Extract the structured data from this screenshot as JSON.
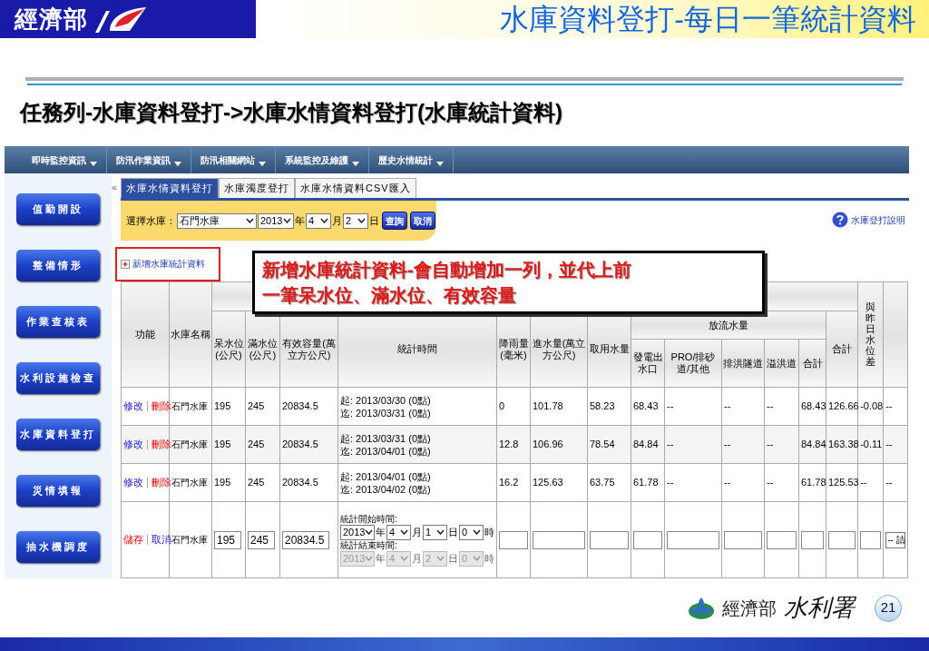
{
  "slide": {
    "org": "經濟部",
    "title": "水庫資料登打-每日一筆統計資料",
    "subtitle": "任務列-水庫資料登打->水庫水情資料登打(水庫統計資料)",
    "footer_org": "經濟部",
    "footer_agency": "水利署",
    "page": "21"
  },
  "menu": [
    {
      "label": "即時監控資訊"
    },
    {
      "label": "防汛作業資訊"
    },
    {
      "label": "防汛相關網站"
    },
    {
      "label": "系統監控及維護"
    },
    {
      "label": "歷史水情統計"
    }
  ],
  "sidebar": {
    "collapse": "«",
    "items": [
      "值勤開設",
      "整備情形",
      "作業查核表",
      "水利設施檢查",
      "水庫資料登打",
      "災情填報",
      "抽水機調度"
    ]
  },
  "tabs": [
    {
      "label": "水庫水情資料登打",
      "selected": true
    },
    {
      "label": "水庫濁度登打",
      "selected": false
    },
    {
      "label": "水庫水情資料CSV匯入",
      "selected": false
    }
  ],
  "filter": {
    "label": "選擇水庫：",
    "reservoir": "石門水庫",
    "parts": [
      {
        "value": "2013",
        "unit": "年"
      },
      {
        "value": "4",
        "unit": "月"
      },
      {
        "value": "2",
        "unit": "日"
      }
    ],
    "buttons": [
      "查詢",
      "取消"
    ]
  },
  "help_link": "水庫登打說明",
  "add_link": "新增水庫統計資料",
  "callout": [
    "新增水庫統計資料-會自動增加一列，並代上前",
    "一筆呆水位、滿水位、有效容量"
  ],
  "table": {
    "head": {
      "function": "功能",
      "name": "水庫名稱",
      "dead": "呆水位(公尺)",
      "full": "滿水位(公尺)",
      "capacity": "有效容量(萬立方公尺)",
      "period": "統計時間",
      "rain": "降雨量(毫米)",
      "inflow": "進水量(萬立方公尺)",
      "use": "取用水量",
      "release": "放流水量",
      "release_cols": [
        "發電出水口",
        "PRO/排砂道/其他",
        "排洪隧道",
        "溢洪道",
        "合計"
      ],
      "total": "合計",
      "diff": "與昨日水位差"
    },
    "rows": [
      {
        "actions": [
          {
            "label": "修改",
            "kind": "edit"
          },
          {
            "label": "刪除",
            "kind": "delete"
          }
        ],
        "name": "石門水庫",
        "values": [
          "195",
          "245",
          "20834.5"
        ],
        "start": "起: 2013/03/30 (0點)",
        "end": "迄: 2013/03/31 (0點)",
        "stats": [
          "0",
          "101.78",
          "58.23",
          "68.43",
          "--",
          "--",
          "--",
          "68.43",
          "126.66",
          "-0.08",
          "--"
        ]
      },
      {
        "actions": [
          {
            "label": "修改",
            "kind": "edit"
          },
          {
            "label": "刪除",
            "kind": "delete"
          }
        ],
        "name": "石門水庫",
        "values": [
          "195",
          "245",
          "20834.5"
        ],
        "start": "起: 2013/03/31 (0點)",
        "end": "迄: 2013/04/01 (0點)",
        "stats": [
          "12.8",
          "106.96",
          "78.54",
          "84.84",
          "--",
          "--",
          "--",
          "84.84",
          "163.38",
          "-0.11",
          "--"
        ]
      },
      {
        "actions": [
          {
            "label": "修改",
            "kind": "edit"
          },
          {
            "label": "刪除",
            "kind": "delete"
          }
        ],
        "name": "石門水庫",
        "values": [
          "195",
          "245",
          "20834.5"
        ],
        "start": "起: 2013/04/01 (0點)",
        "end": "迄: 2013/04/02 (0點)",
        "stats": [
          "16.2",
          "125.63",
          "63.75",
          "61.78",
          "--",
          "--",
          "--",
          "61.78",
          "125.53",
          "--",
          "--"
        ]
      }
    ],
    "edit_row": {
      "actions": [
        {
          "label": "儲存",
          "kind": "delete"
        },
        {
          "label": "取消",
          "kind": "edit"
        }
      ],
      "name": "石門水庫",
      "values": [
        "195",
        "245",
        "20834.5"
      ],
      "times": [
        {
          "label": "統計開始時間:",
          "disabled": false,
          "parts": [
            {
              "value": "2013",
              "unit": "年"
            },
            {
              "value": "4",
              "unit": "月"
            },
            {
              "value": "1",
              "unit": "日"
            },
            {
              "value": "0",
              "unit": "時"
            }
          ]
        },
        {
          "label": "統計結束時間:",
          "disabled": true,
          "parts": [
            {
              "value": "2013",
              "unit": "年"
            },
            {
              "value": "4",
              "unit": "月"
            },
            {
              "value": "2",
              "unit": "日"
            },
            {
              "value": "0",
              "unit": "時"
            }
          ]
        }
      ],
      "blank_fields": [
        {
          "kind": "input"
        },
        {
          "kind": "input"
        },
        {
          "kind": "input"
        },
        {
          "kind": "input"
        },
        {
          "kind": "input"
        },
        {
          "kind": "input"
        },
        {
          "kind": "input"
        },
        {
          "kind": "input"
        },
        {
          "kind": "input"
        },
        {
          "kind": "input"
        }
      ],
      "last_select": "-- 請"
    }
  }
}
